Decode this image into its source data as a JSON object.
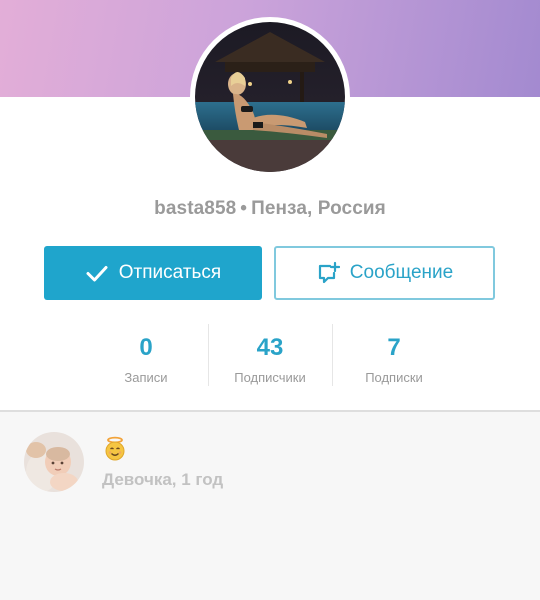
{
  "profile": {
    "username": "basta858",
    "separator": "•",
    "location": "Пенза, Россия"
  },
  "actions": {
    "unsubscribe_label": "Отписаться",
    "message_label": "Сообщение"
  },
  "stats": [
    {
      "value": "0",
      "label": "Записи"
    },
    {
      "value": "43",
      "label": "Подписчики"
    },
    {
      "value": "7",
      "label": "Подписки"
    }
  ],
  "child": {
    "description": "Девочка, 1 год"
  },
  "colors": {
    "accent": "#1fa5cc",
    "accent_text": "#2aa3c8",
    "muted_text": "#9a9a9a"
  },
  "icons": {
    "unsubscribe": "checkmark-icon",
    "message": "chat-add-icon",
    "child_emoji": "angel-face-icon"
  }
}
